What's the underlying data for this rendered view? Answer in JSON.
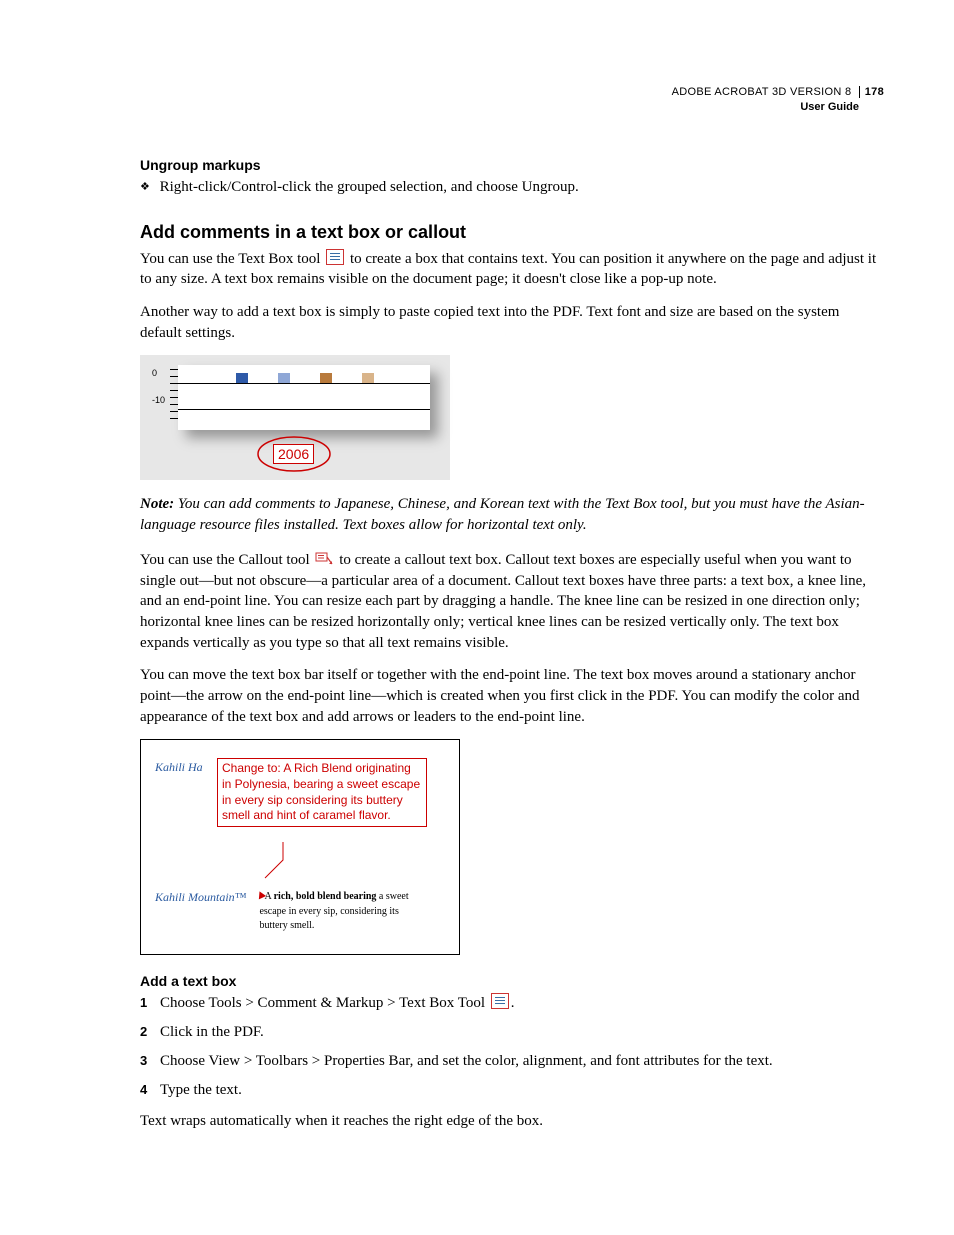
{
  "header": {
    "product": "ADOBE ACROBAT 3D VERSION 8",
    "page_number": "178",
    "subtitle": "User Guide"
  },
  "ungroup": {
    "heading": "Ungroup markups",
    "text": "Right-click/Control-click the grouped selection, and choose Ungroup."
  },
  "section": {
    "heading": "Add comments in a text box or callout",
    "para1a": "You can use the Text Box tool ",
    "para1b": " to create a box that contains text. You can position it anywhere on the page and adjust it to any size. A text box remains visible on the document page; it doesn't close like a pop-up note.",
    "para2": "Another way to add a text box is simply to paste copied text into the PDF. Text font and size are based on the system default settings."
  },
  "fig1": {
    "y0": "0",
    "y10": "-10",
    "year": "2006"
  },
  "note": {
    "label": "Note:",
    "text": " You can add comments to Japanese, Chinese, and Korean text with the Text Box tool, but you must have the Asian-language resource files installed. Text boxes allow for horizontal text only."
  },
  "callout": {
    "para1a": "You can use the Callout tool ",
    "para1b": " to create a callout text box. Callout text boxes are especially useful when you want to single out—but not obscure—a particular area of a document. Callout text boxes have three parts: a text box, a knee line, and an end-point line. You can resize each part by dragging a handle. The knee line can be resized in one direction only; horizontal knee lines can be resized horizontally only; vertical knee lines can be resized vertically only. The text box expands vertically as you type so that all text remains visible.",
    "para2": "You can move the text box bar itself or together with the end-point line. The text box moves around a stationary anchor point—the arrow on the end-point line—which is created when you first click in the PDF. You can modify the color and appearance of the text box and add arrows or leaders to the end-point line."
  },
  "fig2": {
    "kahili_ha": "Kahili Ha",
    "callout_text": "Change to: A Rich Blend originating in Polynesia, bearing a sweet escape in every sip considering its buttery smell and hint of caramel flavor.",
    "kahili_mt": "Kahili Mountain™",
    "body_bold": "rich, bold blend bearing",
    "body_rest": "a sweet escape in every sip, considering its buttery smell."
  },
  "add_text_box": {
    "heading": "Add a text box",
    "steps": [
      "Choose Tools > Comment & Markup > Text Box Tool ",
      "Click in the PDF.",
      "Choose View > Toolbars > Properties Bar, and set the color, alignment, and font attributes for the text.",
      "Type the text."
    ],
    "tail": "Text wraps automatically when it reaches the right edge of the box."
  }
}
